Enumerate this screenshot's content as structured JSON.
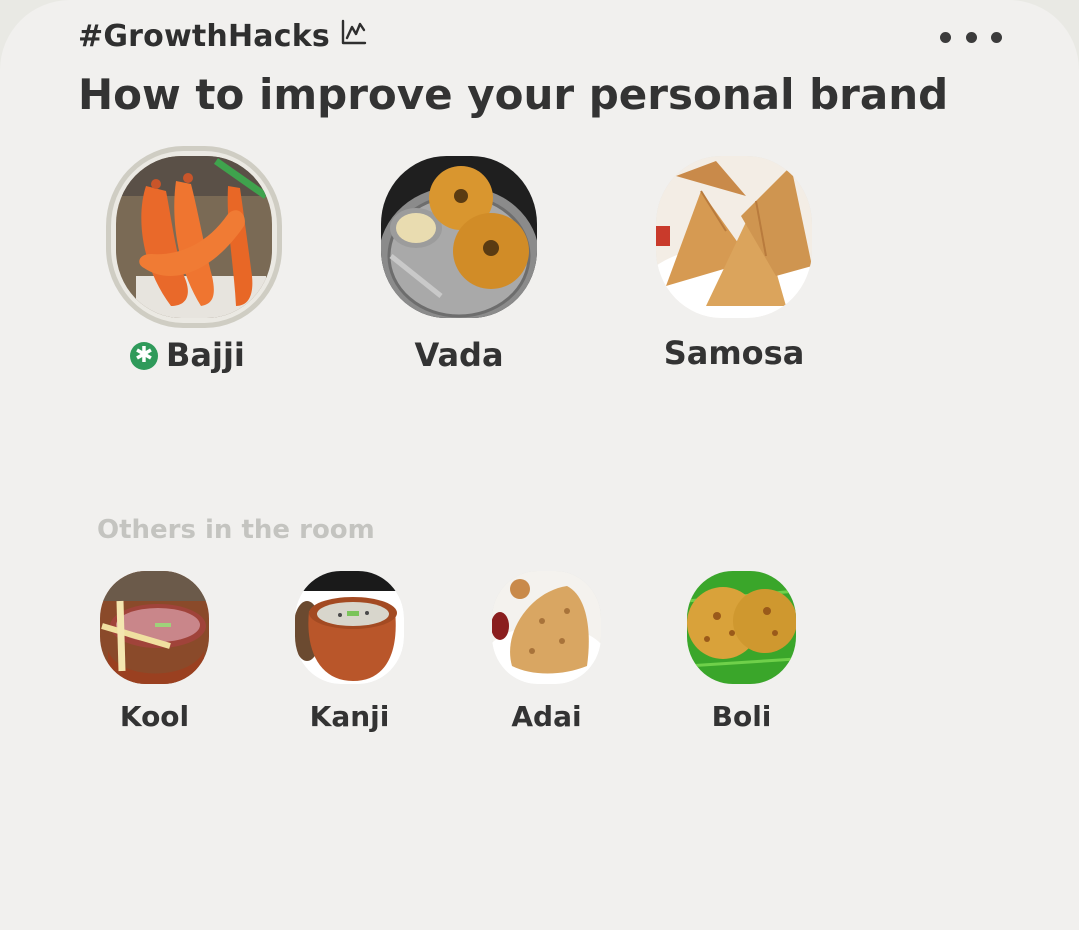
{
  "room": {
    "club_tag": "#GrowthHacks",
    "club_icon": "chart-line-icon",
    "title": "How to improve your personal brand",
    "menu_icon": "more-horizontal-icon"
  },
  "speakers": [
    {
      "name": "Bajji",
      "moderator": true,
      "speaking": true,
      "avatar": "bajji-photo"
    },
    {
      "name": "Vada",
      "moderator": false,
      "speaking": false,
      "avatar": "vada-photo"
    },
    {
      "name": "Samosa",
      "moderator": false,
      "speaking": false,
      "avatar": "samosa-photo"
    }
  ],
  "others": {
    "label": "Others in the room",
    "people": [
      {
        "name": "Kool",
        "avatar": "kool-photo"
      },
      {
        "name": "Kanji",
        "avatar": "kanji-photo"
      },
      {
        "name": "Adai",
        "avatar": "adai-photo"
      },
      {
        "name": "Boli",
        "avatar": "boli-photo"
      }
    ]
  },
  "colors": {
    "background": "#f1f0ee",
    "moderator_badge": "#2f9a5a",
    "text": "#333333",
    "muted_label": "#c4c4c0"
  }
}
